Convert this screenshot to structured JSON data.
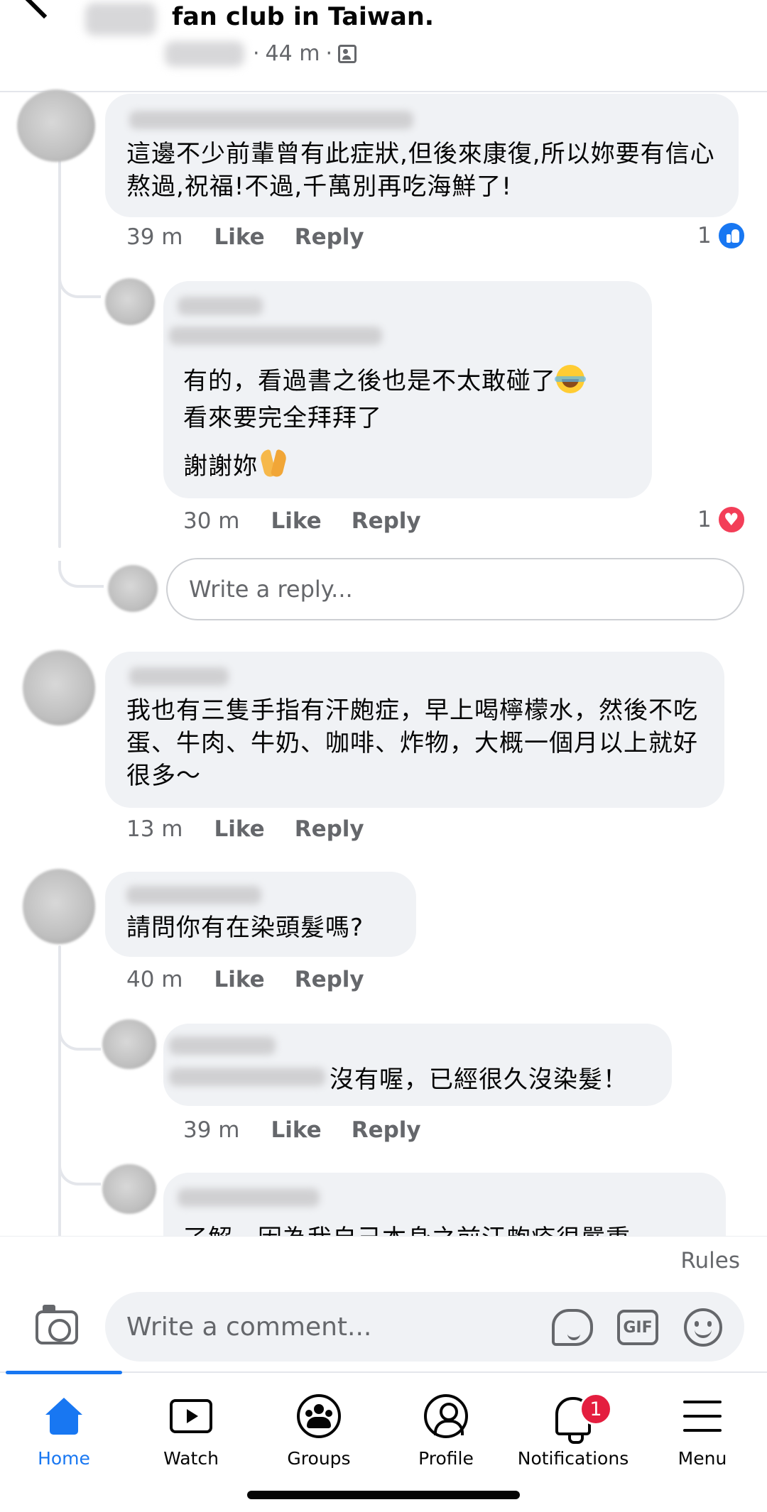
{
  "header": {
    "title": "fan club in Taiwan.",
    "time": "44 m",
    "separator": "·"
  },
  "comments": [
    {
      "text": "這邊不少前輩曾有此症狀,但後來康復,所以妳要有信心熬過,祝福!不過,千萬別再吃海鮮了!",
      "time": "39 m",
      "like": "Like",
      "reply": "Reply",
      "reaction_count": "1",
      "reaction": "like-icon",
      "replies": [
        {
          "line1": "有的，看過書之後也是不太敢碰了",
          "line2": "看來要完全拜拜了",
          "line3": "謝謝妳",
          "time": "30 m",
          "like": "Like",
          "reply": "Reply",
          "reaction_count": "1",
          "reaction": "love-icon"
        }
      ],
      "reply_placeholder": "Write a reply..."
    },
    {
      "text": "我也有三隻手指有汗皰症，早上喝檸檬水，然後不吃蛋、牛肉、牛奶、咖啡、炸物，大概一個月以上就好很多～",
      "time": "13 m",
      "like": "Like",
      "reply": "Reply"
    },
    {
      "text": "請問你有在染頭髮嗎?",
      "time": "40 m",
      "like": "Like",
      "reply": "Reply",
      "replies": [
        {
          "text": "沒有喔，已經很久沒染髮！",
          "time": "39 m",
          "like": "Like",
          "reply": "Reply"
        },
        {
          "text": "了解，因為我自己本身之前汗皰疹很嚴重"
        }
      ]
    }
  ],
  "composer": {
    "rules": "Rules",
    "placeholder": "Write a comment...",
    "gif": "GIF"
  },
  "nav": {
    "items": [
      {
        "label": "Home",
        "icon": "home-icon",
        "active": true
      },
      {
        "label": "Watch",
        "icon": "watch-icon"
      },
      {
        "label": "Groups",
        "icon": "groups-icon"
      },
      {
        "label": "Profile",
        "icon": "profile-icon"
      },
      {
        "label": "Notifications",
        "icon": "bell-icon",
        "badge": "1"
      },
      {
        "label": "Menu",
        "icon": "menu-icon"
      }
    ]
  },
  "colors": {
    "accent": "#1877f2",
    "bubble": "#f0f2f5",
    "secondary_text": "#65676b",
    "badge": "#e41e3f"
  }
}
